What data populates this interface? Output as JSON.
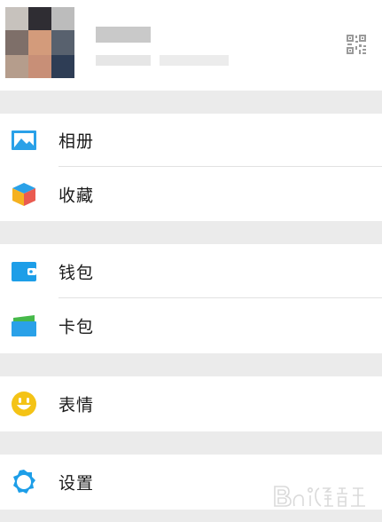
{
  "menu": {
    "items": [
      {
        "id": "album",
        "label": "相册",
        "icon": "photo-album-icon",
        "color": "#2aa1e8"
      },
      {
        "id": "favorites",
        "label": "收藏",
        "icon": "favorites-cube-icon",
        "color": "#f0a22c"
      },
      {
        "id": "wallet",
        "label": "钱包",
        "icon": "wallet-icon",
        "color": "#1d9ee8"
      },
      {
        "id": "cards",
        "label": "卡包",
        "icon": "card-pack-icon",
        "color": "#2aa1e8"
      },
      {
        "id": "stickers",
        "label": "表情",
        "icon": "smiley-icon",
        "color": "#f4c316"
      },
      {
        "id": "settings",
        "label": "设置",
        "icon": "gear-icon",
        "color": "#1d9ee8"
      }
    ]
  },
  "profile": {
    "qr_icon": "qr-code-icon"
  },
  "colors": {
    "separator": "#ebebeb",
    "accent_blue": "#2aa1e8"
  }
}
